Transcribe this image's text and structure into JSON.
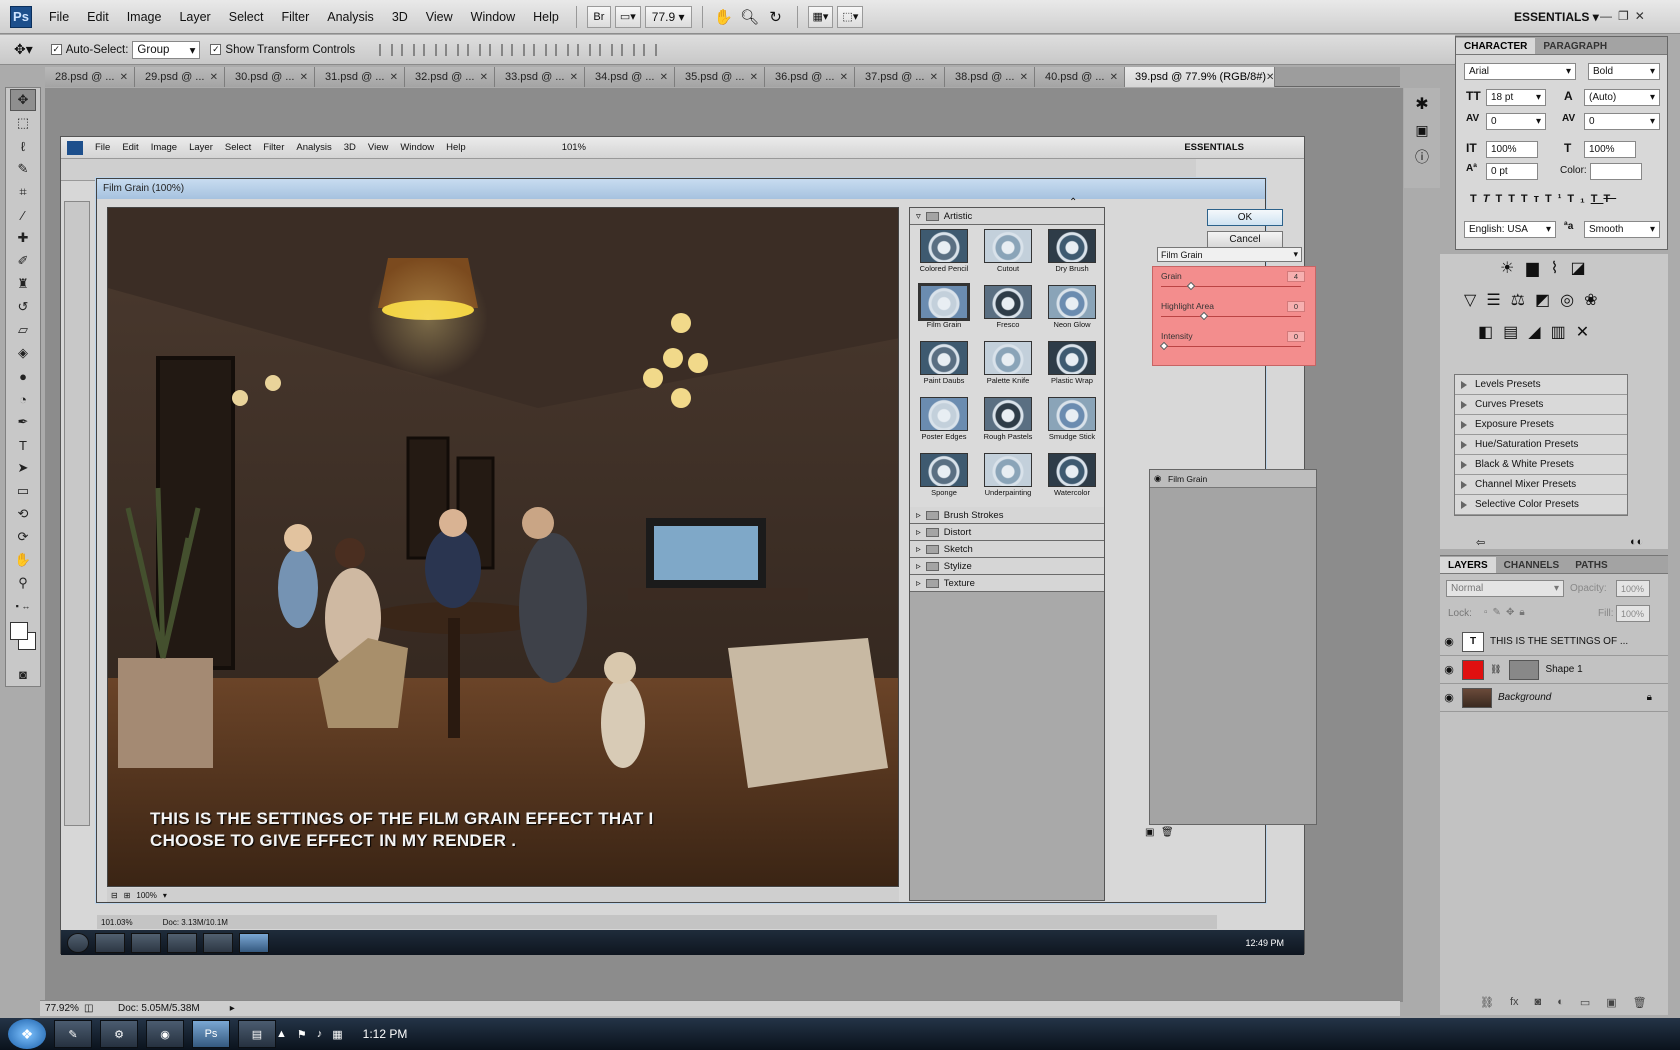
{
  "menubar": {
    "logo": "Ps",
    "items": [
      "File",
      "Edit",
      "Image",
      "Layer",
      "Select",
      "Filter",
      "Analysis",
      "3D",
      "View",
      "Window",
      "Help"
    ],
    "bridge": "Br",
    "zoom": "77.9",
    "workspace": "ESSENTIALS"
  },
  "options": {
    "auto_select_label": "Auto-Select:",
    "auto_select_value": "Group",
    "show_transform_label": "Show Transform Controls"
  },
  "tabs": [
    "28.psd @ ...",
    "29.psd @ ...",
    "30.psd @ ...",
    "31.psd @ ...",
    "32.psd @ ...",
    "33.psd @ ...",
    "34.psd @ ...",
    "35.psd @ ...",
    "36.psd @ ...",
    "37.psd @ ...",
    "38.psd @ ...",
    "40.psd @ ...",
    "39.psd @ 77.9% (RGB/8#)"
  ],
  "inner_window": {
    "menu": [
      "File",
      "Edit",
      "Image",
      "Layer",
      "Select",
      "Filter",
      "Analysis",
      "3D",
      "View",
      "Window",
      "Help"
    ],
    "zoom": "101%",
    "workspace": "ESSENTIALS",
    "status_zoom": "101.03%",
    "status_doc": "Doc: 3.13M/10.1M",
    "clock": "12:49 PM"
  },
  "dialog": {
    "title": "Film Grain (100%)",
    "overlay_line1": "THIS IS THE SETTINGS OF THE FILM GRAIN EFFECT THAT I",
    "overlay_line2": "CHOOSE TO GIVE EFFECT IN MY RENDER .",
    "preview_zoom": "100%",
    "ok": "OK",
    "cancel": "Cancel",
    "selected_filter": "Film Grain",
    "params": [
      {
        "label": "Grain",
        "value": "4",
        "level": 0.2
      },
      {
        "label": "Highlight Area",
        "value": "0",
        "level": 0.3
      },
      {
        "label": "Intensity",
        "value": "0",
        "level": 0.0
      }
    ],
    "effect_layer": "Film Grain",
    "open_folder": "Artistic",
    "thumbnails": [
      "Colored Pencil",
      "Cutout",
      "Dry Brush",
      "Film Grain",
      "Fresco",
      "Neon Glow",
      "Paint Daubs",
      "Palette Knife",
      "Plastic Wrap",
      "Poster Edges",
      "Rough Pastels",
      "Smudge Stick",
      "Sponge",
      "Underpainting",
      "Watercolor"
    ],
    "folders": [
      "Brush Strokes",
      "Distort",
      "Sketch",
      "Stylize",
      "Texture"
    ]
  },
  "character": {
    "tabs": [
      "CHARACTER",
      "PARAGRAPH"
    ],
    "font_family": "Arial",
    "font_style": "Bold",
    "size": "18 pt",
    "leading": "(Auto)",
    "kerning": "0",
    "tracking": "0",
    "vscale": "100%",
    "hscale": "100%",
    "baseline": "0 pt",
    "color_label": "Color:",
    "language": "English: USA",
    "aa_label": "a",
    "antialias": "Smooth"
  },
  "adjustments": {
    "presets": [
      "Levels Presets",
      "Curves Presets",
      "Exposure Presets",
      "Hue/Saturation Presets",
      "Black & White Presets",
      "Channel Mixer Presets",
      "Selective Color Presets"
    ]
  },
  "layers": {
    "tabs": [
      "LAYERS",
      "CHANNELS",
      "PATHS"
    ],
    "blend_mode": "Normal",
    "opacity_label": "Opacity:",
    "opacity": "100%",
    "lock_label": "Lock:",
    "fill_label": "Fill:",
    "fill": "100%",
    "items": [
      {
        "name": "THIS IS THE SETTINGS OF ...",
        "thumb": "T"
      },
      {
        "name": "Shape 1",
        "thumb": ""
      },
      {
        "name": "Background",
        "thumb": ""
      }
    ]
  },
  "status": {
    "zoom": "77.92%",
    "doc": "Doc: 5.05M/5.38M"
  },
  "taskbar": {
    "clock": "1:12 PM"
  },
  "colors": {
    "param_panel": "#f38d8d",
    "shape_swatch": "#e01010"
  }
}
